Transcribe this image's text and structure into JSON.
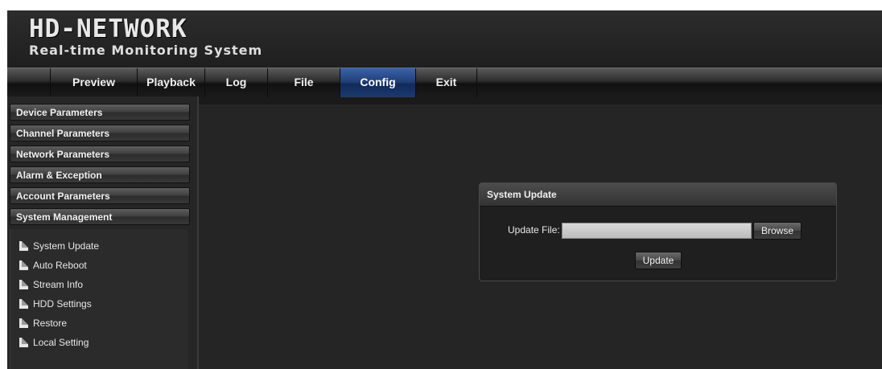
{
  "brand": {
    "title": "HD-NETWORK",
    "subtitle": "Real-time Monitoring System"
  },
  "nav": {
    "items": [
      {
        "label": "Preview"
      },
      {
        "label": "Playback"
      },
      {
        "label": "Log"
      },
      {
        "label": "File"
      },
      {
        "label": "Config",
        "active": true
      },
      {
        "label": "Exit"
      }
    ]
  },
  "sidebar": {
    "sections": [
      {
        "label": "Device Parameters"
      },
      {
        "label": "Channel Parameters"
      },
      {
        "label": "Network Parameters"
      },
      {
        "label": "Alarm & Exception"
      },
      {
        "label": "Account Parameters"
      },
      {
        "label": "System Management",
        "expanded": true
      }
    ],
    "submenu": [
      {
        "label": "System Update",
        "icon": "document-icon"
      },
      {
        "label": "Auto Reboot",
        "icon": "document-icon"
      },
      {
        "label": "Stream Info",
        "icon": "document-icon"
      },
      {
        "label": "HDD Settings",
        "icon": "document-icon"
      },
      {
        "label": "Restore",
        "icon": "document-icon"
      },
      {
        "label": "Local Setting",
        "icon": "document-icon"
      }
    ]
  },
  "panel": {
    "title": "System Update",
    "file_label": "Update File:",
    "file_value": "",
    "browse_label": "Browse",
    "update_label": "Update"
  },
  "colors": {
    "active_tab": "#1f3e78",
    "background": "#1a1a1a"
  }
}
